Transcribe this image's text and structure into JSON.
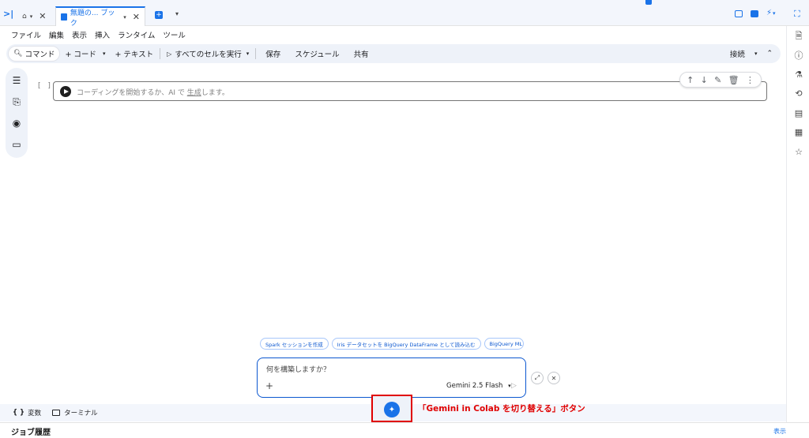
{
  "tabbar": {
    "tab_home_icon": "home-icon",
    "tab_active_label": "無題の... ブック",
    "new_tab_icon": "plus-square-icon"
  },
  "menu": [
    "ファイル",
    "編集",
    "表示",
    "挿入",
    "ランタイム",
    "ツール"
  ],
  "toolbar": {
    "command": "コマンド",
    "code": "+ コード",
    "text": "+ テキスト",
    "run_all": "すべてのセルを実行",
    "save": "保存",
    "schedule": "スケジュール",
    "share": "共有",
    "connect": "接続"
  },
  "cell": {
    "bracket": "[ ]",
    "placeholder_prefix": "コーディングを開始するか、AI で",
    "placeholder_link": "生成",
    "placeholder_suffix": "します。"
  },
  "gemini": {
    "chips": [
      "Spark セッションを作成",
      "Iris データセットを BigQuery DataFrame として読み込む",
      "BigQuery ML"
    ],
    "placeholder": "何を構築しますか？",
    "add": "+",
    "model": "Gemini 2.5 Flash",
    "annotation": "「Gemini in Colab を切り替える」ボタン"
  },
  "bottombar": {
    "variables": "変数",
    "terminal": "ターミナル"
  },
  "jobs": {
    "title": "ジョブ履歴",
    "show": "表示"
  },
  "colors": {
    "accent": "#1a73e8",
    "gemini_blue": "#0b57d0",
    "highlight_red": "#e00000"
  }
}
